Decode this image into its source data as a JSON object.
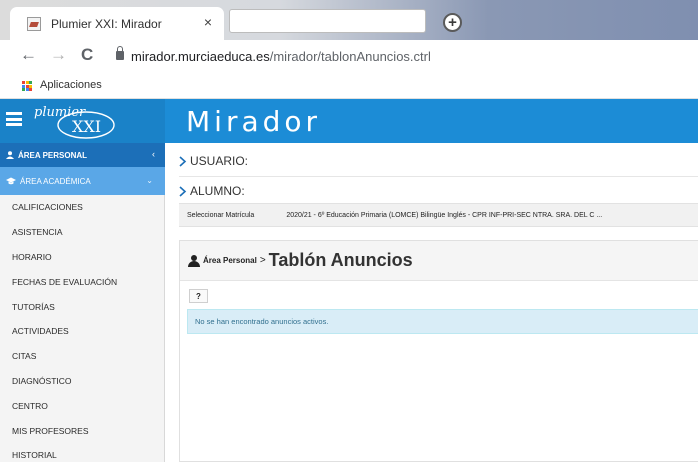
{
  "browser": {
    "tab_title": "Plumier XXI: Mirador",
    "tab_close": "×",
    "new_tab": "+",
    "url_host": "mirador.murciaeduca.es",
    "url_path": "/mirador/tablonAnuncios.ctrl",
    "bookmark_apps": "Aplicaciones",
    "nav_back": "←",
    "nav_forward": "→",
    "nav_reload": "C"
  },
  "header": {
    "logo_text": "plumier",
    "logo_sub": "XXI",
    "title": "Mirador"
  },
  "sidebar": {
    "personal": "ÁREA PERSONAL",
    "personal_chevron": "‹",
    "academica": "ÁREA ACADÉMICA",
    "academica_chevron": "⌄",
    "items": [
      "CALIFICACIONES",
      "ASISTENCIA",
      "HORARIO",
      "FECHAS DE EVALUACIÓN",
      "TUTORÍAS",
      "ACTIVIDADES",
      "CITAS",
      "DIAGNÓSTICO",
      "CENTRO",
      "MIS PROFESORES",
      "HISTORIAL"
    ]
  },
  "main": {
    "usuario_label": "USUARIO:",
    "alumno_label": "ALUMNO:",
    "matricula_label": "Seleccionar Matrícula",
    "matricula_value": "2020/21 - 6º Educación Primaria (LOMCE) Bilingüe Inglés - CPR INF-PRI-SEC NTRA. SRA. DEL C ...",
    "breadcrumb_area": "Área Personal",
    "breadcrumb_sep": ">",
    "page_title": "Tablón Anuncios",
    "help_label": "?",
    "alert_text": "No se han encontrado anuncios activos."
  },
  "colors": {
    "header_blue": "#1c8cd6",
    "sidebar_active": "#1c6fb8",
    "sidebar_section": "#5aa7e7",
    "alert_bg": "#d9edf7"
  }
}
